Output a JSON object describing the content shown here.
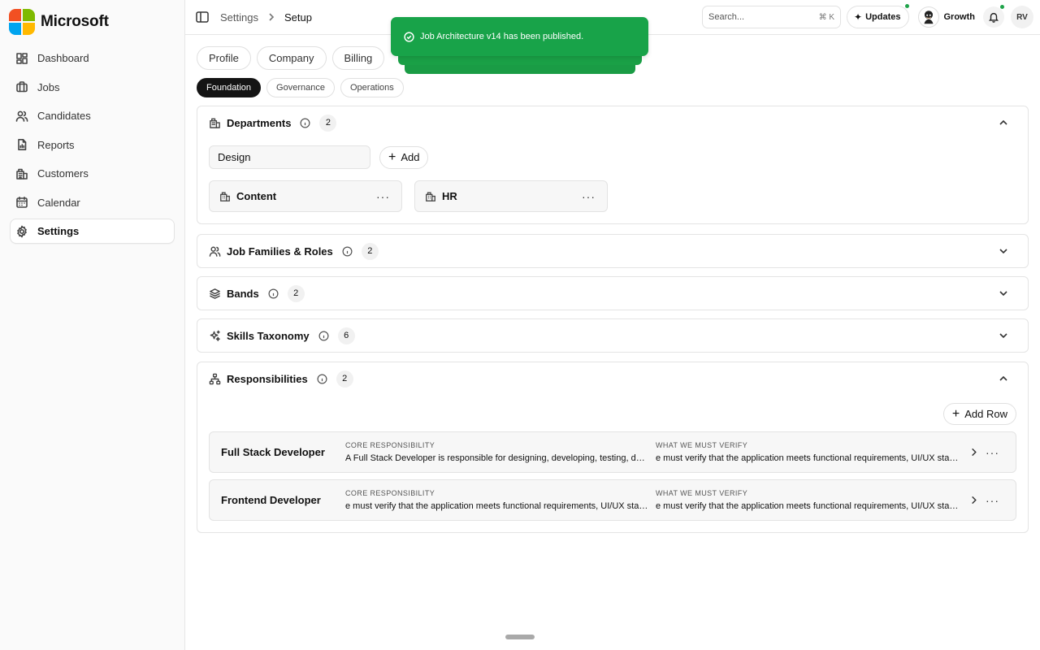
{
  "brand": {
    "name": "Microsoft",
    "logo_colors": [
      "#f25022",
      "#7fba00",
      "#00a4ef",
      "#ffb900"
    ]
  },
  "sidebar": {
    "items": [
      {
        "label": "Dashboard",
        "icon": "dashboard-icon"
      },
      {
        "label": "Jobs",
        "icon": "briefcase-icon"
      },
      {
        "label": "Candidates",
        "icon": "users-icon"
      },
      {
        "label": "Reports",
        "icon": "report-icon"
      },
      {
        "label": "Customers",
        "icon": "building-icon"
      },
      {
        "label": "Calendar",
        "icon": "calendar-icon"
      },
      {
        "label": "Settings",
        "icon": "gear-icon",
        "active": true
      }
    ]
  },
  "topbar": {
    "breadcrumb": [
      "Settings",
      "Setup"
    ],
    "search_placeholder": "Search...",
    "search_shortcut": "⌘ K",
    "updates_label": "Updates",
    "workspace_label": "Growth",
    "user_initials": "RV",
    "status_dot_color": "#1fa34a"
  },
  "toast": {
    "message": "Job Architecture v14 has been published.",
    "color": "#18a349"
  },
  "tabs": [
    "Profile",
    "Company",
    "Billing"
  ],
  "subtabs": [
    {
      "label": "Foundation",
      "active": true
    },
    {
      "label": "Governance"
    },
    {
      "label": "Operations"
    }
  ],
  "sections": {
    "departments": {
      "title": "Departments",
      "count": "2",
      "expanded": true,
      "input_value": "Design",
      "add_label": "Add",
      "items": [
        "Content",
        "HR"
      ]
    },
    "job_families": {
      "title": "Job Families & Roles",
      "count": "2"
    },
    "bands": {
      "title": "Bands",
      "count": "2"
    },
    "skills": {
      "title": "Skills Taxonomy",
      "count": "6"
    },
    "responsibilities": {
      "title": "Responsibilities",
      "count": "2",
      "expanded": true,
      "add_row_label": "Add Row",
      "col1_label": "CORE RESPONSIBILITY",
      "col2_label": "WHAT WE MUST VERIFY",
      "rows": [
        {
          "role": "Full Stack Developer",
          "core": "A Full Stack Developer is responsible for designing, developing, testing, deploying and maintaining applications",
          "verify": "e must verify that the application meets functional requirements, UI/UX standards and performance"
        },
        {
          "role": "Frontend Developer",
          "core": "e must verify that the application meets functional requirements, UI/UX standards and performance",
          "verify": "e must verify that the application meets functional requirements, UI/UX standards and performance"
        }
      ]
    }
  }
}
